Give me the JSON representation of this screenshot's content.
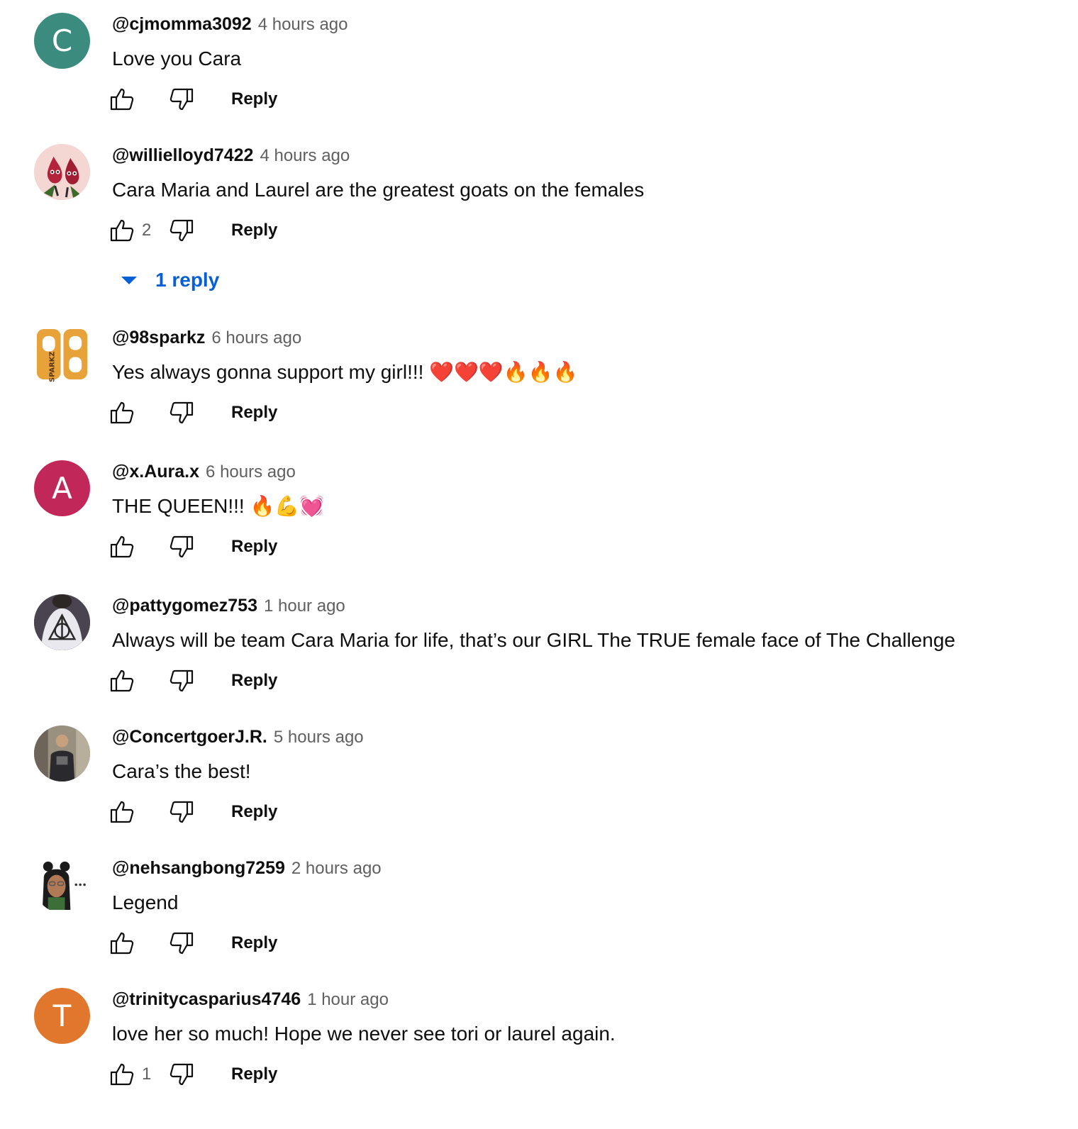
{
  "icons": {
    "like": "thumbs-up-icon",
    "dislike": "thumbs-down-icon",
    "expand": "caret-down-icon"
  },
  "colors": {
    "text_primary": "#0f0f0f",
    "text_secondary": "#606060",
    "link_blue": "#065fd4"
  },
  "comments": [
    {
      "author": "@cjmomma3092",
      "time": "4 hours ago",
      "text": "Love you Cara",
      "likes": "",
      "reply_label": "Reply",
      "avatar": {
        "type": "letter",
        "letter": "C",
        "color": "#3c8b7f"
      }
    },
    {
      "author": "@willielloyd7422",
      "time": "4 hours ago",
      "text": "Cara Maria and Laurel are the greatest goats on the females",
      "likes": "2",
      "reply_label": "Reply",
      "replies_label": "1 reply",
      "avatar": {
        "type": "image",
        "name": "cartoon-drops-avatar"
      }
    },
    {
      "author": "@98sparkz",
      "time": "6 hours ago",
      "text": "Yes always gonna support my girl!!! ❤️❤️❤️🔥🔥🔥",
      "likes": "",
      "reply_label": "Reply",
      "avatar": {
        "type": "logo",
        "name": "98-sparkz-logo",
        "logo_text": "98",
        "logo_subtext": "SPARKZ"
      }
    },
    {
      "author": "@x.Aura.x",
      "time": "6 hours ago",
      "text": "THE QUEEN!!! 🔥💪💓",
      "likes": "",
      "reply_label": "Reply",
      "avatar": {
        "type": "letter",
        "letter": "A",
        "color": "#c2275a"
      }
    },
    {
      "author": "@pattygomez753",
      "time": "1 hour ago",
      "text": "Always will be team Cara Maria for life, that’s our GIRL  The TRUE female face of The Challenge",
      "likes": "",
      "reply_label": "Reply",
      "avatar": {
        "type": "image",
        "name": "deathly-hallows-shirt-avatar"
      }
    },
    {
      "author": "@ConcertgoerJ.R.",
      "time": "5 hours ago",
      "text": "Cara’s the best!",
      "likes": "",
      "reply_label": "Reply",
      "avatar": {
        "type": "image",
        "name": "person-photo-avatar"
      }
    },
    {
      "author": "@nehsangbong7259",
      "time": "2 hours ago",
      "text": "Legend",
      "likes": "",
      "reply_label": "Reply",
      "avatar": {
        "type": "image",
        "name": "bitmoji-avatar"
      }
    },
    {
      "author": "@trinitycasparius4746",
      "time": "1 hour ago",
      "text": "love her so much! Hope we never see tori or laurel again.",
      "likes": "1",
      "reply_label": "Reply",
      "avatar": {
        "type": "letter",
        "letter": "T",
        "color": "#e0772d"
      }
    }
  ]
}
